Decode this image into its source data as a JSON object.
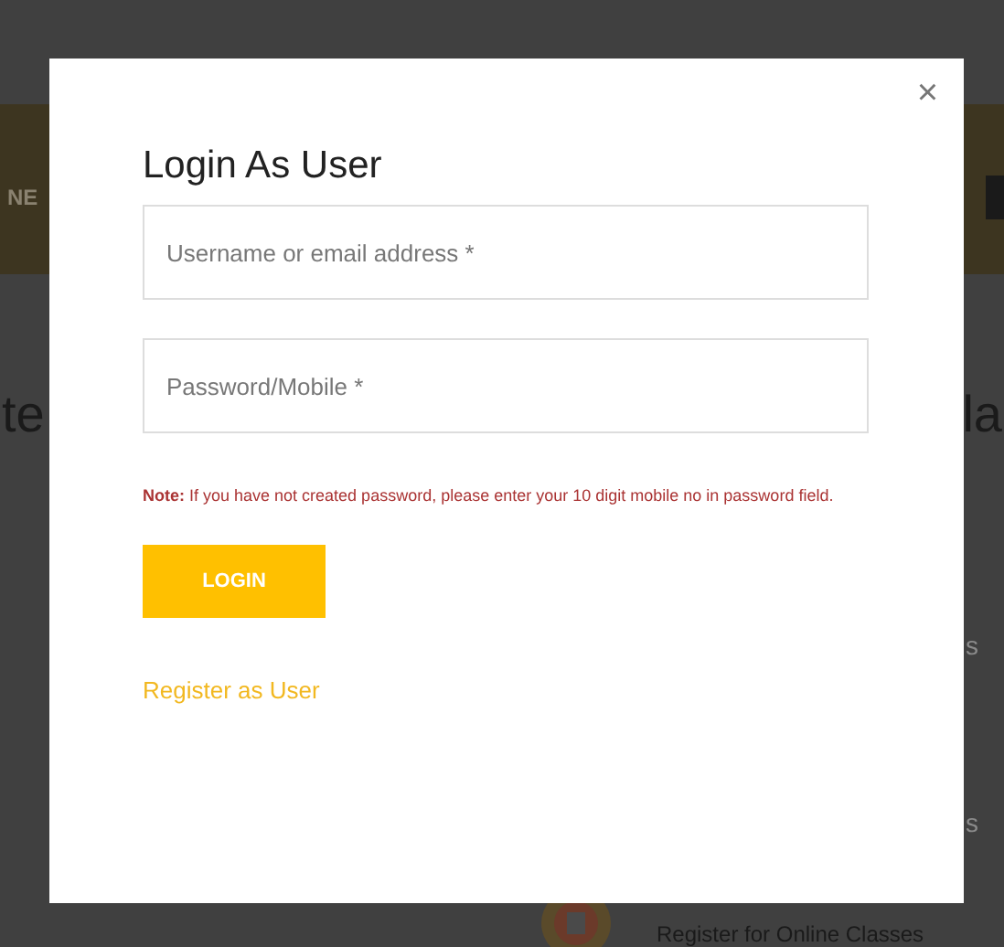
{
  "background_page": {
    "nav_text": "NE",
    "heading_left": "te",
    "heading_right": "la",
    "side_texts": [
      "s",
      "s"
    ],
    "bottom_link": "Register for Online Classes"
  },
  "login_modal": {
    "close": "×",
    "title": "Login As User",
    "fields": [
      {
        "placeholder": "Username or email address *"
      },
      {
        "placeholder": "Password/Mobile *"
      }
    ],
    "note": "**Note:** If you have not created password, please enter your 10 digit mobile no in password field.",
    "login_button": "LOGIN",
    "register_link": "Register as User"
  }
}
